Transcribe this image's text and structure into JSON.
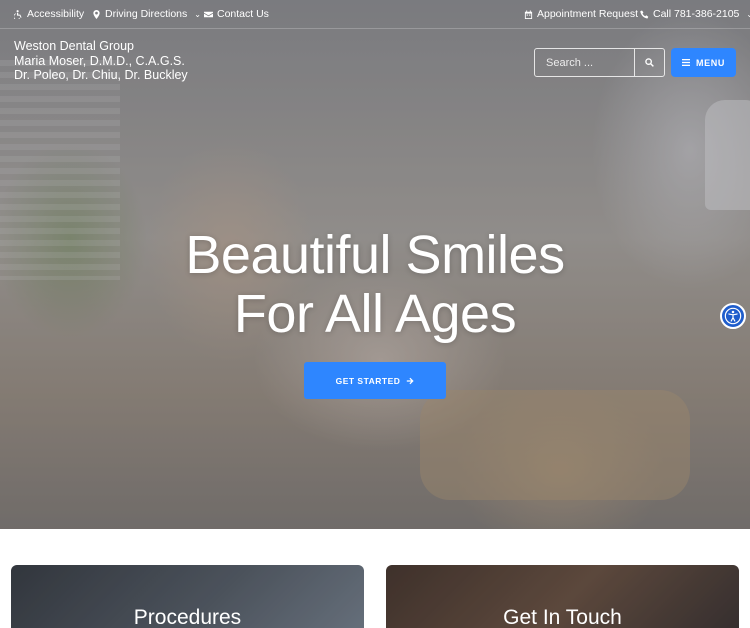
{
  "topbar": {
    "accessibility": "Accessibility",
    "directions": "Driving Directions",
    "contact": "Contact Us",
    "appointment": "Appointment Request",
    "call": "Call 781-386-2105"
  },
  "brand": {
    "line1": "Weston Dental Group",
    "line2": "Maria Moser, D.M.D., C.A.G.S.",
    "line3": "Dr. Poleo, Dr. Chiu, Dr. Buckley"
  },
  "search": {
    "placeholder": "Search ..."
  },
  "menu": {
    "label": "MENU"
  },
  "hero": {
    "headline_line1": "Beautiful Smiles",
    "headline_line2": "For All Ages",
    "cta_label": "GET STARTED"
  },
  "cards": [
    {
      "title": "Procedures"
    },
    {
      "title": "Get In Touch"
    }
  ],
  "colors": {
    "accent": "#2e86ff",
    "accessibility_widget": "#1f5dcc"
  },
  "icons": [
    "wheelchair-icon",
    "map-marker-icon",
    "envelope-icon",
    "calendar-icon",
    "phone-icon",
    "search-icon",
    "hamburger-icon",
    "arrow-right-icon",
    "accessibility-person-icon"
  ]
}
